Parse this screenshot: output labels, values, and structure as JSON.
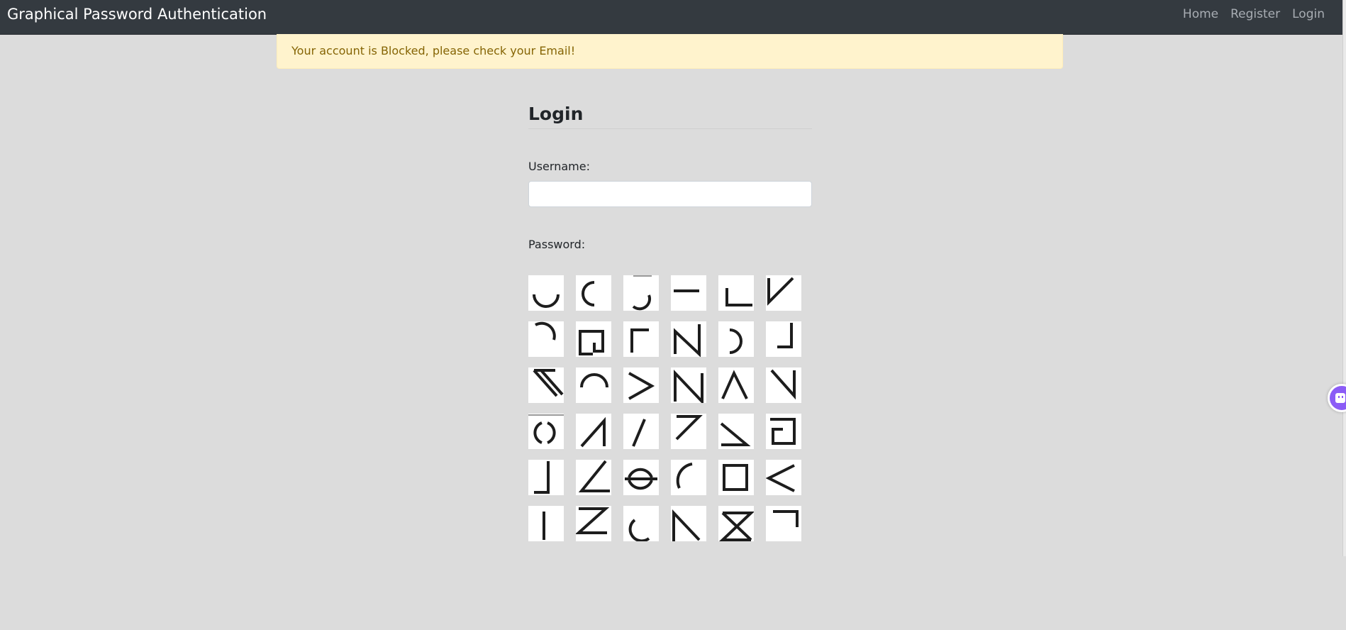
{
  "navbar": {
    "brand": "Graphical Password Authentication",
    "links": [
      "Home",
      "Register",
      "Login"
    ]
  },
  "alert": {
    "message": "Your account is Blocked, please check your Email!"
  },
  "form": {
    "title": "Login",
    "username_label": "Username:",
    "username_value": "",
    "password_label": "Password:"
  },
  "password_grid": {
    "tiles": [
      "arc-bottom-icon",
      "arc-left-icon",
      "arc-bottom-right-icon",
      "horizontal-line-icon",
      "corner-bottom-left-icon",
      "v-slash-icon",
      "arc-top-right-icon",
      "double-square-bracket-icon",
      "corner-top-left-icon",
      "n-shape-icon",
      "arc-right-icon",
      "corner-bottom-right-icon",
      "diagonal-top-left-icon",
      "arc-top-icon",
      "greater-than-icon",
      "letter-n-icon",
      "caret-up-icon",
      "diagonal-down-right-icon",
      "circle-split-icon",
      "triangle-slash-icon",
      "forward-slash-icon",
      "seven-shape-icon",
      "triangle-down-right-icon",
      "bracket-square-icon",
      "corner-bottom-right-small-icon",
      "angle-icon",
      "circle-open-icon",
      "arc-top-left-icon",
      "square-icon",
      "less-than-icon",
      "vertical-line-icon",
      "letter-z-icon",
      "arc-bottom-left-icon",
      "triangle-left-icon",
      "sigma-shape-icon",
      "corner-top-right-icon"
    ]
  },
  "widget": {
    "icon": "chat-bot-icon",
    "color": "#8b5cf6"
  }
}
